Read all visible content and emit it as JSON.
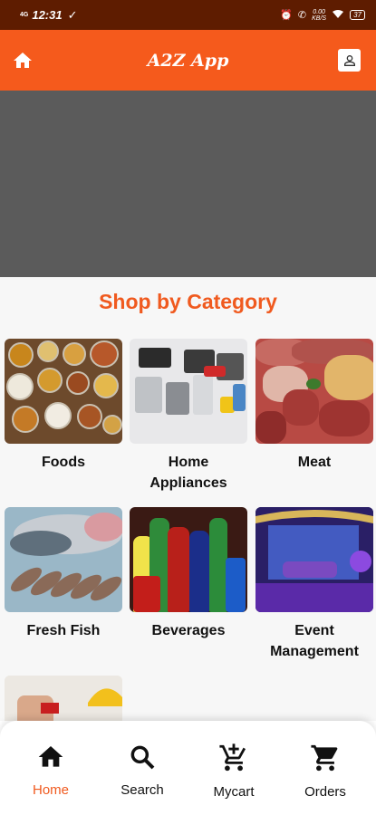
{
  "status_bar": {
    "network": "4G",
    "time": "12:31",
    "speed": "0.00",
    "speed_unit": "KB/S",
    "battery": "37"
  },
  "app_bar": {
    "title": "A2Z App",
    "home_icon": "home-icon",
    "profile_icon": "person-icon"
  },
  "section": {
    "title": "Shop by Category"
  },
  "categories": [
    {
      "label": "Foods"
    },
    {
      "label": "Home\nAppliances"
    },
    {
      "label": "Meat"
    },
    {
      "label": "Fresh Fish"
    },
    {
      "label": "Beverages"
    },
    {
      "label": "Event\nManagement"
    }
  ],
  "bottom_nav": [
    {
      "label": "Home",
      "icon": "home-icon",
      "active": true
    },
    {
      "label": "Search",
      "icon": "search-icon",
      "active": false
    },
    {
      "label": "Mycart",
      "icon": "add-cart-icon",
      "active": false
    },
    {
      "label": "Orders",
      "icon": "cart-icon",
      "active": false
    }
  ],
  "colors": {
    "primary": "#f55a1c",
    "status_bar": "#5e1c00",
    "accent_text": "#f05a1f",
    "banner_placeholder": "#5b5b5b"
  }
}
